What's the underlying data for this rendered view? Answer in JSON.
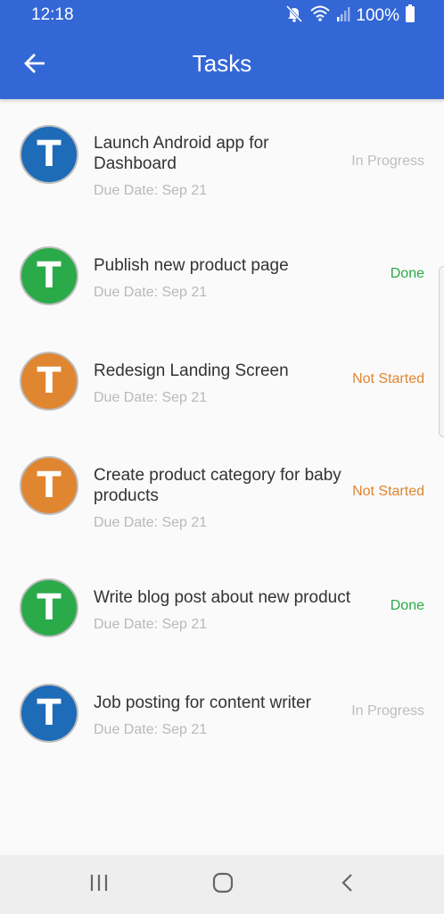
{
  "status_bar": {
    "time": "12:18",
    "battery_percent": "100%",
    "icons": [
      "mute-icon",
      "wifi-icon",
      "signal-icon",
      "battery-icon"
    ]
  },
  "app_bar": {
    "title": "Tasks",
    "back_icon": "arrow-left-icon"
  },
  "tasks": [
    {
      "avatar_letter": "T",
      "avatar_color": "#1e6bb8",
      "title": "Launch Android app for Dashboard",
      "due": "Due Date: Sep 21",
      "status": "In Progress",
      "status_color": "#bdbdbd"
    },
    {
      "avatar_letter": "T",
      "avatar_color": "#2baa4a",
      "title": "Publish new product page",
      "due": "Due Date: Sep 21",
      "status": "Done",
      "status_color": "#2baa4a"
    },
    {
      "avatar_letter": "T",
      "avatar_color": "#e08530",
      "title": "Redesign Landing Screen",
      "due": "Due Date: Sep 21",
      "status": "Not Started",
      "status_color": "#e08530"
    },
    {
      "avatar_letter": "T",
      "avatar_color": "#e08530",
      "title": "Create product category for baby products",
      "due": "Due Date: Sep 21",
      "status": "Not Started",
      "status_color": "#e08530"
    },
    {
      "avatar_letter": "T",
      "avatar_color": "#2baa4a",
      "title": "Write blog post about new product",
      "due": "Due Date: Sep 21",
      "status": "Done",
      "status_color": "#2baa4a"
    },
    {
      "avatar_letter": "T",
      "avatar_color": "#1e6bb8",
      "title": "Job posting for content writer",
      "due": "Due Date: Sep 21",
      "status": "In Progress",
      "status_color": "#bdbdbd"
    }
  ],
  "nav_bar": {
    "icons": [
      "recent-apps-icon",
      "home-icon",
      "back-icon"
    ]
  }
}
